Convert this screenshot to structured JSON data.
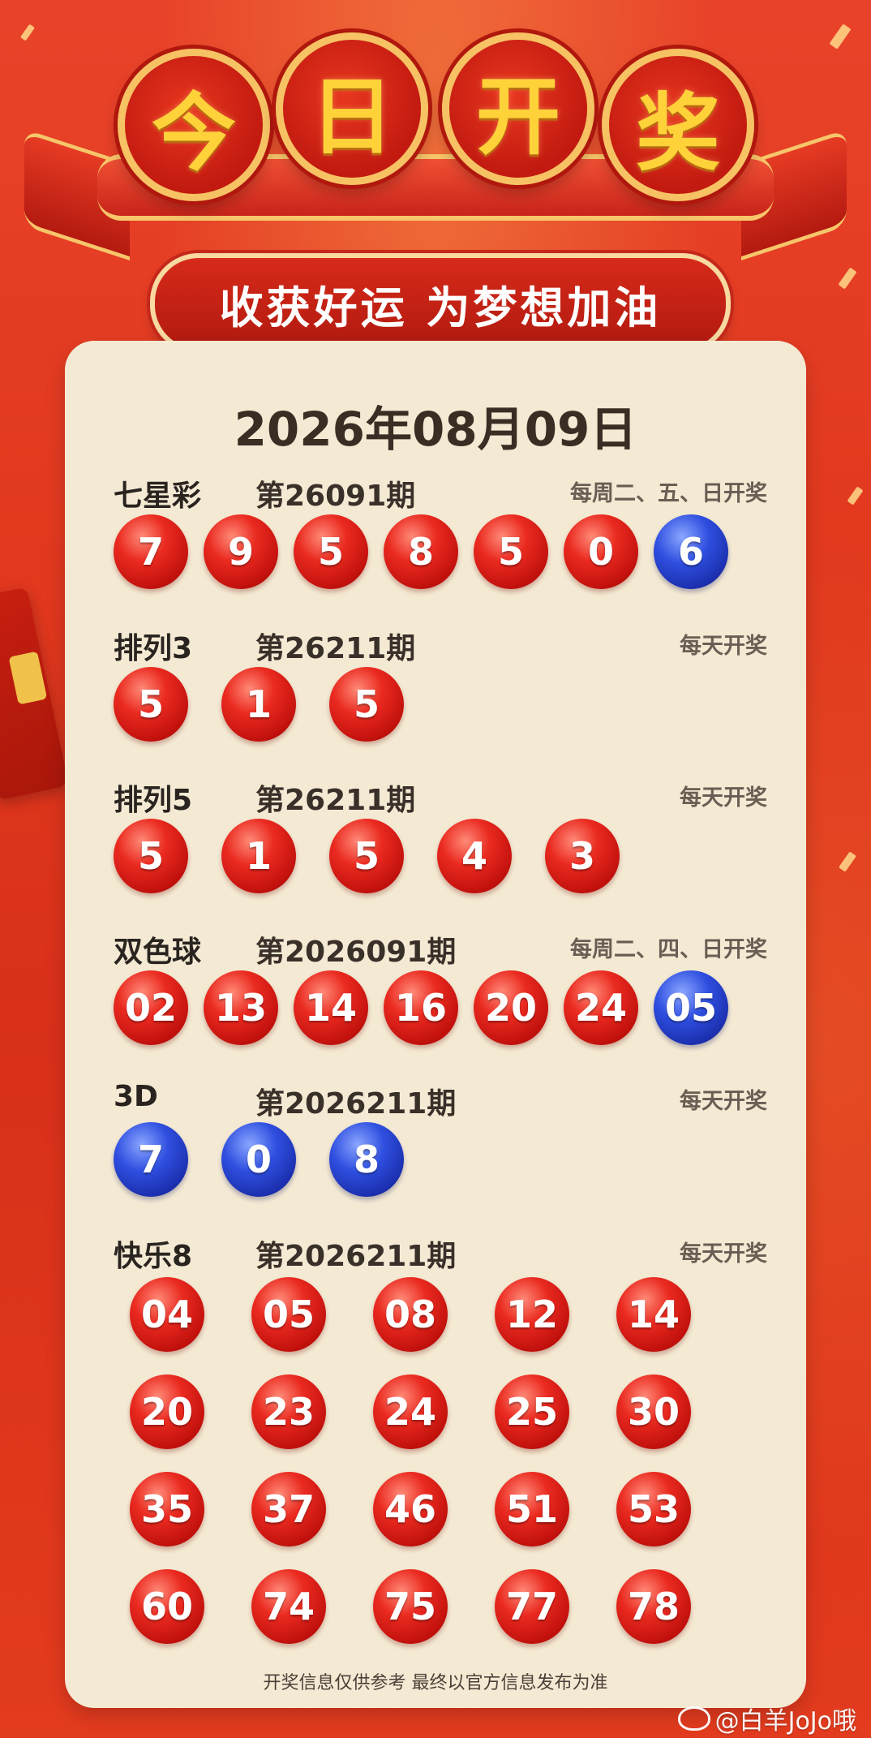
{
  "header": {
    "title_chars": [
      "今",
      "日",
      "开",
      "奖"
    ],
    "slogan": "收获好运 为梦想加油"
  },
  "date": "2026年08月09日",
  "lotteries": [
    {
      "name": "七星彩",
      "issue": "第26091期",
      "schedule": "每周二、五、日开奖",
      "balls": [
        {
          "n": "7",
          "c": "red"
        },
        {
          "n": "9",
          "c": "red"
        },
        {
          "n": "5",
          "c": "red"
        },
        {
          "n": "8",
          "c": "red"
        },
        {
          "n": "5",
          "c": "red"
        },
        {
          "n": "0",
          "c": "red"
        },
        {
          "n": "6",
          "c": "blue"
        }
      ]
    },
    {
      "name": "排列3",
      "issue": "第26211期",
      "schedule": "每天开奖",
      "balls": [
        {
          "n": "5",
          "c": "red"
        },
        {
          "n": "1",
          "c": "red"
        },
        {
          "n": "5",
          "c": "red"
        }
      ]
    },
    {
      "name": "排列5",
      "issue": "第26211期",
      "schedule": "每天开奖",
      "balls": [
        {
          "n": "5",
          "c": "red"
        },
        {
          "n": "1",
          "c": "red"
        },
        {
          "n": "5",
          "c": "red"
        },
        {
          "n": "4",
          "c": "red"
        },
        {
          "n": "3",
          "c": "red"
        }
      ]
    },
    {
      "name": "双色球",
      "issue": "第2026091期",
      "schedule": "每周二、四、日开奖",
      "balls": [
        {
          "n": "02",
          "c": "red"
        },
        {
          "n": "13",
          "c": "red"
        },
        {
          "n": "14",
          "c": "red"
        },
        {
          "n": "16",
          "c": "red"
        },
        {
          "n": "20",
          "c": "red"
        },
        {
          "n": "24",
          "c": "red"
        },
        {
          "n": "05",
          "c": "blue"
        }
      ]
    },
    {
      "name": "3D",
      "issue": "第2026211期",
      "schedule": "每天开奖",
      "balls": [
        {
          "n": "7",
          "c": "blue"
        },
        {
          "n": "0",
          "c": "blue"
        },
        {
          "n": "8",
          "c": "blue"
        }
      ]
    },
    {
      "name": "快乐8",
      "issue": "第2026211期",
      "schedule": "每天开奖",
      "balls": [
        {
          "n": "04",
          "c": "red"
        },
        {
          "n": "05",
          "c": "red"
        },
        {
          "n": "08",
          "c": "red"
        },
        {
          "n": "12",
          "c": "red"
        },
        {
          "n": "14",
          "c": "red"
        },
        {
          "n": "20",
          "c": "red"
        },
        {
          "n": "23",
          "c": "red"
        },
        {
          "n": "24",
          "c": "red"
        },
        {
          "n": "25",
          "c": "red"
        },
        {
          "n": "30",
          "c": "red"
        },
        {
          "n": "35",
          "c": "red"
        },
        {
          "n": "37",
          "c": "red"
        },
        {
          "n": "46",
          "c": "red"
        },
        {
          "n": "51",
          "c": "red"
        },
        {
          "n": "53",
          "c": "red"
        },
        {
          "n": "60",
          "c": "red"
        },
        {
          "n": "74",
          "c": "red"
        },
        {
          "n": "75",
          "c": "red"
        },
        {
          "n": "77",
          "c": "red"
        },
        {
          "n": "78",
          "c": "red"
        }
      ]
    }
  ],
  "footer": "开奖信息仅供参考 最终以官方信息发布为准",
  "watermark": "@白羊JoJo哦",
  "colors": {
    "background": "#e2391f",
    "card": "#f4ead4",
    "ball_red": "#d8201a",
    "ball_blue": "#2236c0",
    "title_gold": "#ffd23a"
  }
}
